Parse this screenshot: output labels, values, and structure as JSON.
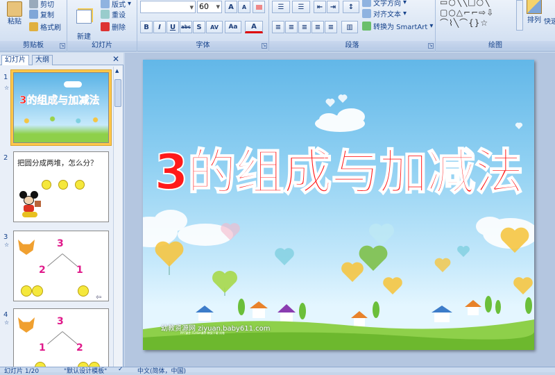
{
  "clipboard": {
    "paste": "粘贴",
    "cut": "剪切",
    "copy": "复制",
    "format_painter": "格式刷",
    "group": "剪贴板"
  },
  "slides_group": {
    "new_slide": "新建\n幻灯片",
    "layout": "版式",
    "reset": "重设",
    "delete": "删除",
    "group": "幻灯片"
  },
  "font": {
    "size": "60",
    "group": "字体",
    "bold": "B",
    "italic": "I",
    "underline": "U",
    "strike": "abc",
    "shadow": "S",
    "spacing": "AV",
    "case": "Aa",
    "color": "A",
    "grow": "A",
    "shrink": "A"
  },
  "paragraph": {
    "text_direction": "文字方向",
    "align_text": "对齐文本",
    "convert_smartart": "转换为 SmartArt",
    "group": "段落"
  },
  "drawing": {
    "arrange": "排列",
    "quick_styles": "快速",
    "group": "绘图"
  },
  "panel": {
    "tab_slides": "幻灯片",
    "tab_outline": "大纲",
    "close": "✕"
  },
  "thumbnails": [
    {
      "num": "1",
      "title": "3的组成与加减法"
    },
    {
      "num": "2",
      "title": "把圆分成两堆，怎么分？"
    },
    {
      "num": "3",
      "top": "3",
      "left": "2",
      "right": "1"
    },
    {
      "num": "4",
      "top": "3",
      "left": "1",
      "right": "2"
    }
  ],
  "slide": {
    "title": "3的组成与加减法",
    "watermark": "幼教资源网 ziyuan.baby611.com",
    "watermark_small": "PPT课件  FLASH课件  教案下载  试卷"
  },
  "status": {
    "slide_count": "幻灯片 1/20",
    "theme": "\"默认设计模板\"",
    "language": "中文(简体，中国)"
  },
  "colors": {
    "title_red": "#ff1a1a",
    "ribbon_text": "#15428b",
    "thumb_selected": "#ffc84a"
  }
}
